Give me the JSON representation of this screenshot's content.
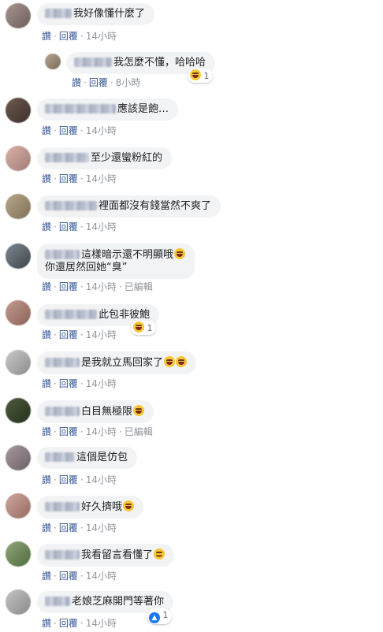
{
  "actions": {
    "like": "讚",
    "reply": "回覆",
    "edited": "已編輯"
  },
  "comments": [
    {
      "text": "我好像懂什麼了",
      "time": "14小時"
    },
    {
      "text": "我怎麼不懂，哈哈哈",
      "time": "8小時",
      "reaction_count": "1"
    },
    {
      "text": "應該是飽…",
      "time": "14小時"
    },
    {
      "text": "至少還蠻粉紅的",
      "time": "14小時"
    },
    {
      "text": "裡面都沒有錢當然不爽了",
      "time": "14小時"
    },
    {
      "text_line1": "這樣暗示還不明顯哦",
      "text_line2": "你還居然回她“臭”",
      "time": "14小時"
    },
    {
      "text": "此包非彼鮑",
      "time": "14小時",
      "reaction_count": "1"
    },
    {
      "text": "是我就立馬回家了",
      "time": "14小時"
    },
    {
      "text": "白目無極限",
      "time": "14小時"
    },
    {
      "text": "這個是仿包",
      "time": "14小時"
    },
    {
      "text": "好久擠哦",
      "time": "14小時"
    },
    {
      "text": "我看留言看懂了",
      "time": "14小時"
    },
    {
      "text": "老娘芝麻開門等著你",
      "time": "14小時",
      "reaction_count": "1"
    }
  ],
  "icons": {
    "laugh": "laughing-emoji-icon",
    "smile": "smiling-emoji-icon",
    "like": "like-reaction-icon"
  },
  "colors": {
    "bubble": "#f2f3f5",
    "link": "#385898",
    "meta": "#90949c",
    "text": "#1c1e21"
  }
}
